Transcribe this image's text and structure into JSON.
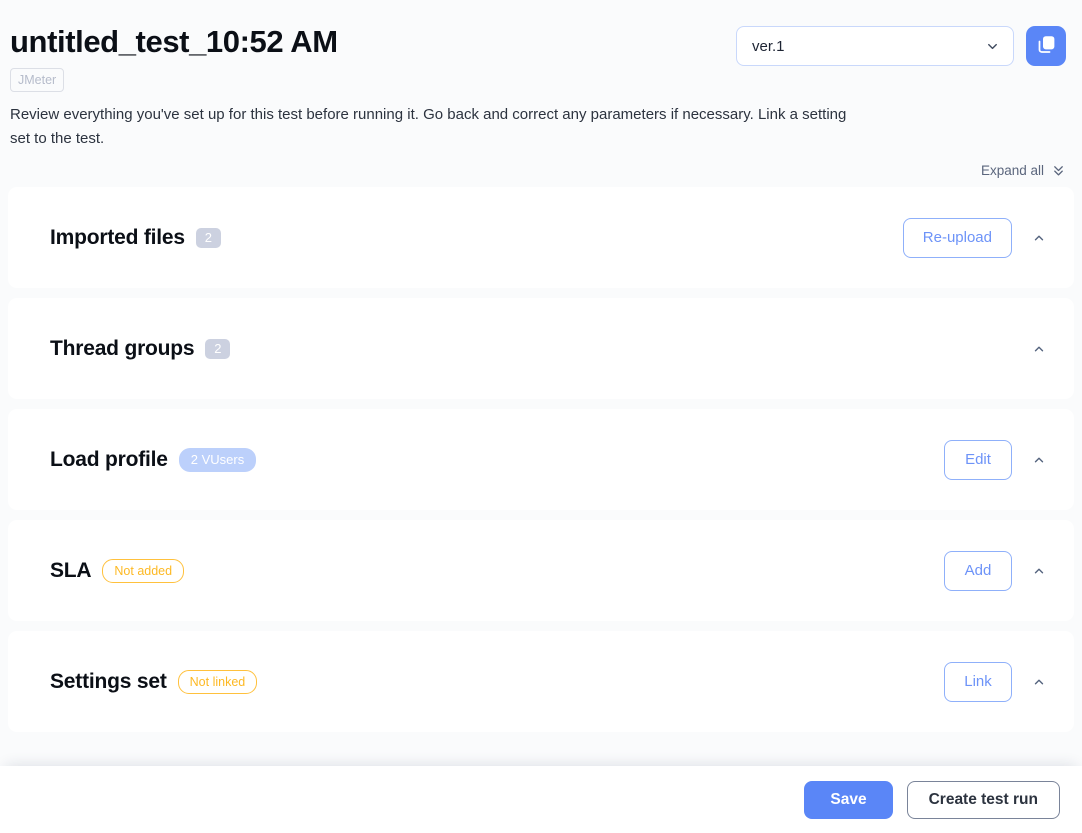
{
  "header": {
    "title": "untitled_test_10:52 AM",
    "engine_tag": "JMeter",
    "description": "Review everything you've set up for this test before running it. Go back and correct any parameters if necessary. Link a setting set to the test.",
    "version": {
      "value": "ver.1",
      "icon": "chevron-down-icon"
    },
    "copy_button": {
      "icon": "copy-icon"
    }
  },
  "expand_all": {
    "label": "Expand all",
    "icon": "double-chevron-down-icon"
  },
  "sections": [
    {
      "title": "Imported files",
      "badge": {
        "text": "2",
        "style": "count"
      },
      "action": "Re-upload",
      "toggle_icon": "chevron-up-icon"
    },
    {
      "title": "Thread groups",
      "badge": {
        "text": "2",
        "style": "count"
      },
      "action": "",
      "toggle_icon": "chevron-up-icon"
    },
    {
      "title": "Load profile",
      "badge": {
        "text": "2 VUsers",
        "style": "blue"
      },
      "action": "Edit",
      "toggle_icon": "chevron-up-icon"
    },
    {
      "title": "SLA",
      "badge": {
        "text": "Not added",
        "style": "warn"
      },
      "action": "Add",
      "toggle_icon": "chevron-up-icon"
    },
    {
      "title": "Settings set",
      "badge": {
        "text": "Not linked",
        "style": "warn"
      },
      "action": "Link",
      "toggle_icon": "chevron-up-icon"
    }
  ],
  "footer": {
    "save_label": "Save",
    "create_label": "Create test run"
  },
  "colors": {
    "accent_blue": "#5a86f7",
    "outline_blue": "#8fb0fa",
    "warn_amber": "#fdb924",
    "badge_gray": "#ccd1e0",
    "badge_blue": "#bcd0fb",
    "page_bg": "#fafbfc"
  }
}
